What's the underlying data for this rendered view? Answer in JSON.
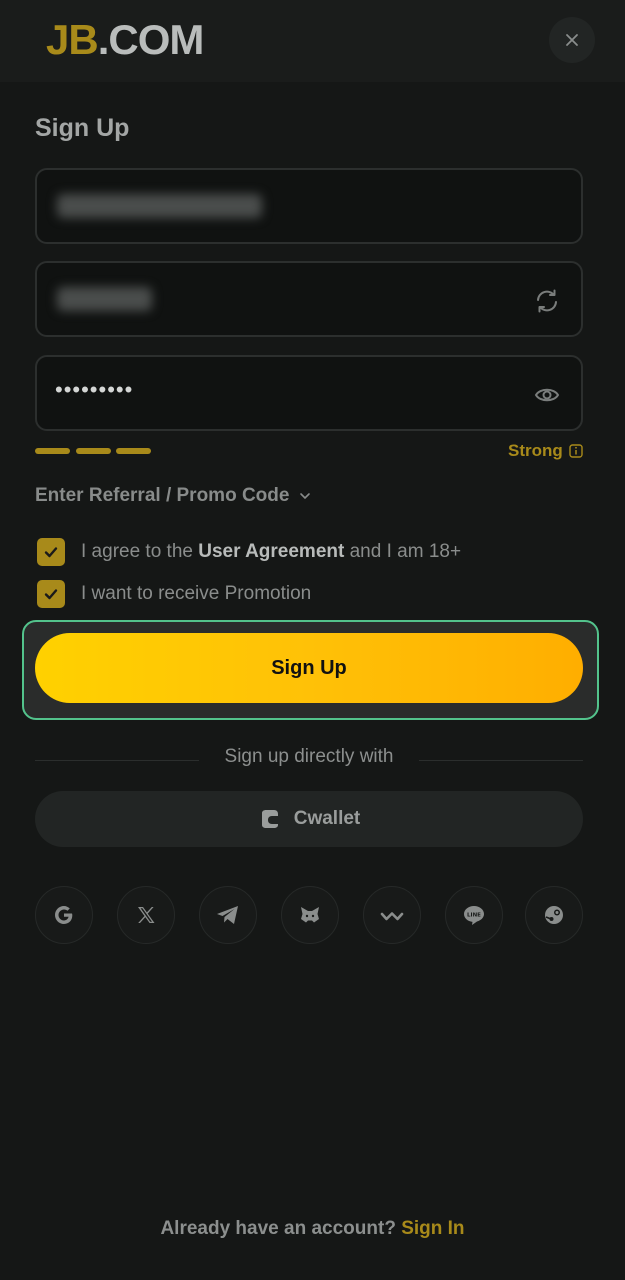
{
  "header": {
    "logo_jb": "JB",
    "logo_com": ".COM",
    "close_icon": "close-icon"
  },
  "form": {
    "title": "Sign Up",
    "email_value": "••••••••••••••••••",
    "username_value": "••••••••••",
    "password_value": "•••••••••",
    "strength_label": "Strong",
    "referral_label": "Enter Referral / Promo Code",
    "agree_prefix": "I agree to the ",
    "agree_link": "User Agreement",
    "agree_suffix": " and I am 18+",
    "promo_label": "I want to receive Promotion",
    "agree_checked": true,
    "promo_checked": true,
    "submit_label": "Sign Up"
  },
  "alt_signup": {
    "divider_text": "Sign up directly with",
    "cwallet_label": "Cwallet",
    "socials": [
      "google-icon",
      "x-icon",
      "telegram-icon",
      "metamask-icon",
      "walletconnect-icon",
      "line-icon",
      "steam-icon"
    ]
  },
  "footer": {
    "prompt": "Already have an account? ",
    "link": "Sign In"
  },
  "colors": {
    "accent": "#a88a1a",
    "button_gradient_start": "#ffd100",
    "button_gradient_end": "#ffae00",
    "focus_ring": "#53c38c",
    "background": "#151716"
  }
}
